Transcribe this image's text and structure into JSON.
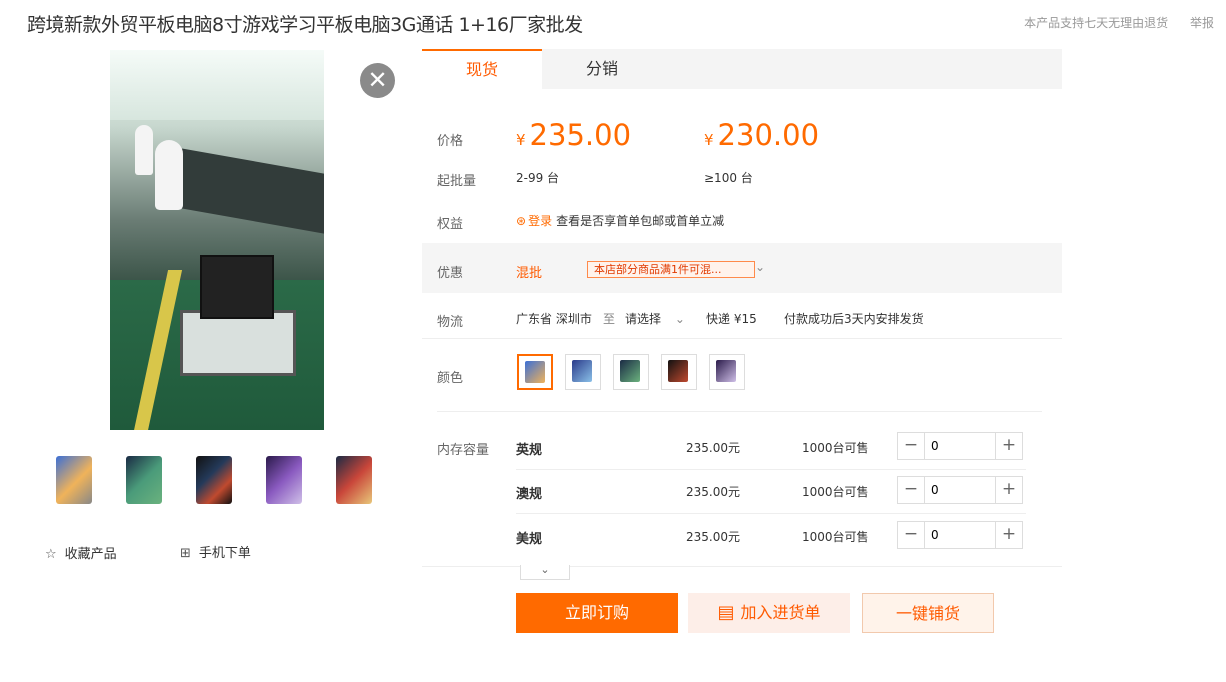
{
  "product": {
    "title": "跨境新款外贸平板电脑8寸游戏学习平板电脑3G通话 1+16厂家批发",
    "return_policy": "本产品支持七天无理由退货",
    "report": "举报"
  },
  "media": {
    "close_symbol": "✕",
    "thumbnail_count": 5
  },
  "actions": {
    "favorite_icon": "☆",
    "favorite": "收藏产品",
    "mobile_icon": "⊞",
    "mobile_order": "手机下单"
  },
  "tabs": [
    {
      "label": "现货",
      "active": true
    },
    {
      "label": "分销",
      "active": false
    }
  ],
  "labels": {
    "price": "价格",
    "moq": "起批量",
    "benefit": "权益",
    "promo": "优惠",
    "logistics": "物流",
    "color": "颜色",
    "memory": "内存容量"
  },
  "pricing": {
    "currency": "¥",
    "tiers": [
      {
        "price": "235.00",
        "range": "2-99 台"
      },
      {
        "price": "230.00",
        "range": "≥100 台"
      }
    ]
  },
  "benefit": {
    "icon": "⊛",
    "login": "登录",
    "text": "查看是否享首单包邮或首单立减"
  },
  "promo": {
    "type": "混批",
    "tag": "本店部分商品满1件可混...",
    "chevron": "⌄"
  },
  "shipping": {
    "from": "广东省 深圳市",
    "to_word": "至",
    "select": "请选择",
    "select_chevron": "⌄",
    "express": "快递 ¥15",
    "delivery": "付款成功后3天内安排发货"
  },
  "colors": {
    "swatch_count": 5,
    "selected_index": 0
  },
  "skus": [
    {
      "name": "英规",
      "price": "235.00元",
      "stock": "1000台可售",
      "qty": "0"
    },
    {
      "name": "澳规",
      "price": "235.00元",
      "stock": "1000台可售",
      "qty": "0"
    },
    {
      "name": "美规",
      "price": "235.00元",
      "stock": "1000台可售",
      "qty": "0"
    }
  ],
  "stepper": {
    "minus": "−",
    "plus": "+"
  },
  "expand_symbol": "⌄",
  "buttons": {
    "buy": "立即订购",
    "cart_icon": "▤",
    "cart": "加入进货单",
    "distribute": "一键铺货"
  },
  "theme": {
    "accent": "#ff6a00"
  }
}
